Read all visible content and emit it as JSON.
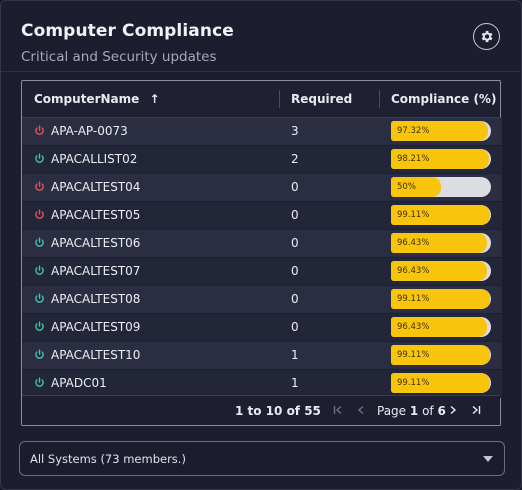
{
  "header": {
    "title": "Computer Compliance",
    "subtitle": "Critical and Security updates"
  },
  "table": {
    "columns": [
      "ComputerName",
      "Required",
      "Compliance (%)"
    ],
    "sort_indicator": "↑",
    "rows": [
      {
        "name": "APA-AP-0073",
        "status": "off",
        "required": "3",
        "compliance": "97.32%",
        "pct": 97.32
      },
      {
        "name": "APACALLIST02",
        "status": "on",
        "required": "2",
        "compliance": "98.21%",
        "pct": 98.21
      },
      {
        "name": "APACALTEST04",
        "status": "off",
        "required": "0",
        "compliance": "50%",
        "pct": 50
      },
      {
        "name": "APACALTEST05",
        "status": "off",
        "required": "0",
        "compliance": "99.11%",
        "pct": 99.11
      },
      {
        "name": "APACALTEST06",
        "status": "on",
        "required": "0",
        "compliance": "96.43%",
        "pct": 96.43
      },
      {
        "name": "APACALTEST07",
        "status": "on",
        "required": "0",
        "compliance": "96.43%",
        "pct": 96.43
      },
      {
        "name": "APACALTEST08",
        "status": "on",
        "required": "0",
        "compliance": "99.11%",
        "pct": 99.11
      },
      {
        "name": "APACALTEST09",
        "status": "on",
        "required": "0",
        "compliance": "96.43%",
        "pct": 96.43
      },
      {
        "name": "APACALTEST10",
        "status": "on",
        "required": "1",
        "compliance": "99.11%",
        "pct": 99.11
      },
      {
        "name": "APADC01",
        "status": "on",
        "required": "1",
        "compliance": "99.11%",
        "pct": 99.11
      }
    ]
  },
  "paging": {
    "summary": "1 to 10 of 55",
    "page_prefix": "Page",
    "page_current": "1",
    "page_of": "of",
    "page_total": "6"
  },
  "select": {
    "value": "All Systems (73 members.)"
  },
  "colors": {
    "status_on": "#3cc8a8",
    "status_off": "#e8525c",
    "bar_fill": "#f9c50c",
    "bar_track": "#dcdde3"
  },
  "icons": {
    "settings": "gear-icon",
    "status": "power-icon",
    "first": "first-page-icon",
    "prev": "prev-page-icon",
    "next": "next-page-icon",
    "last": "last-page-icon",
    "dropdown": "chevron-down-icon"
  }
}
